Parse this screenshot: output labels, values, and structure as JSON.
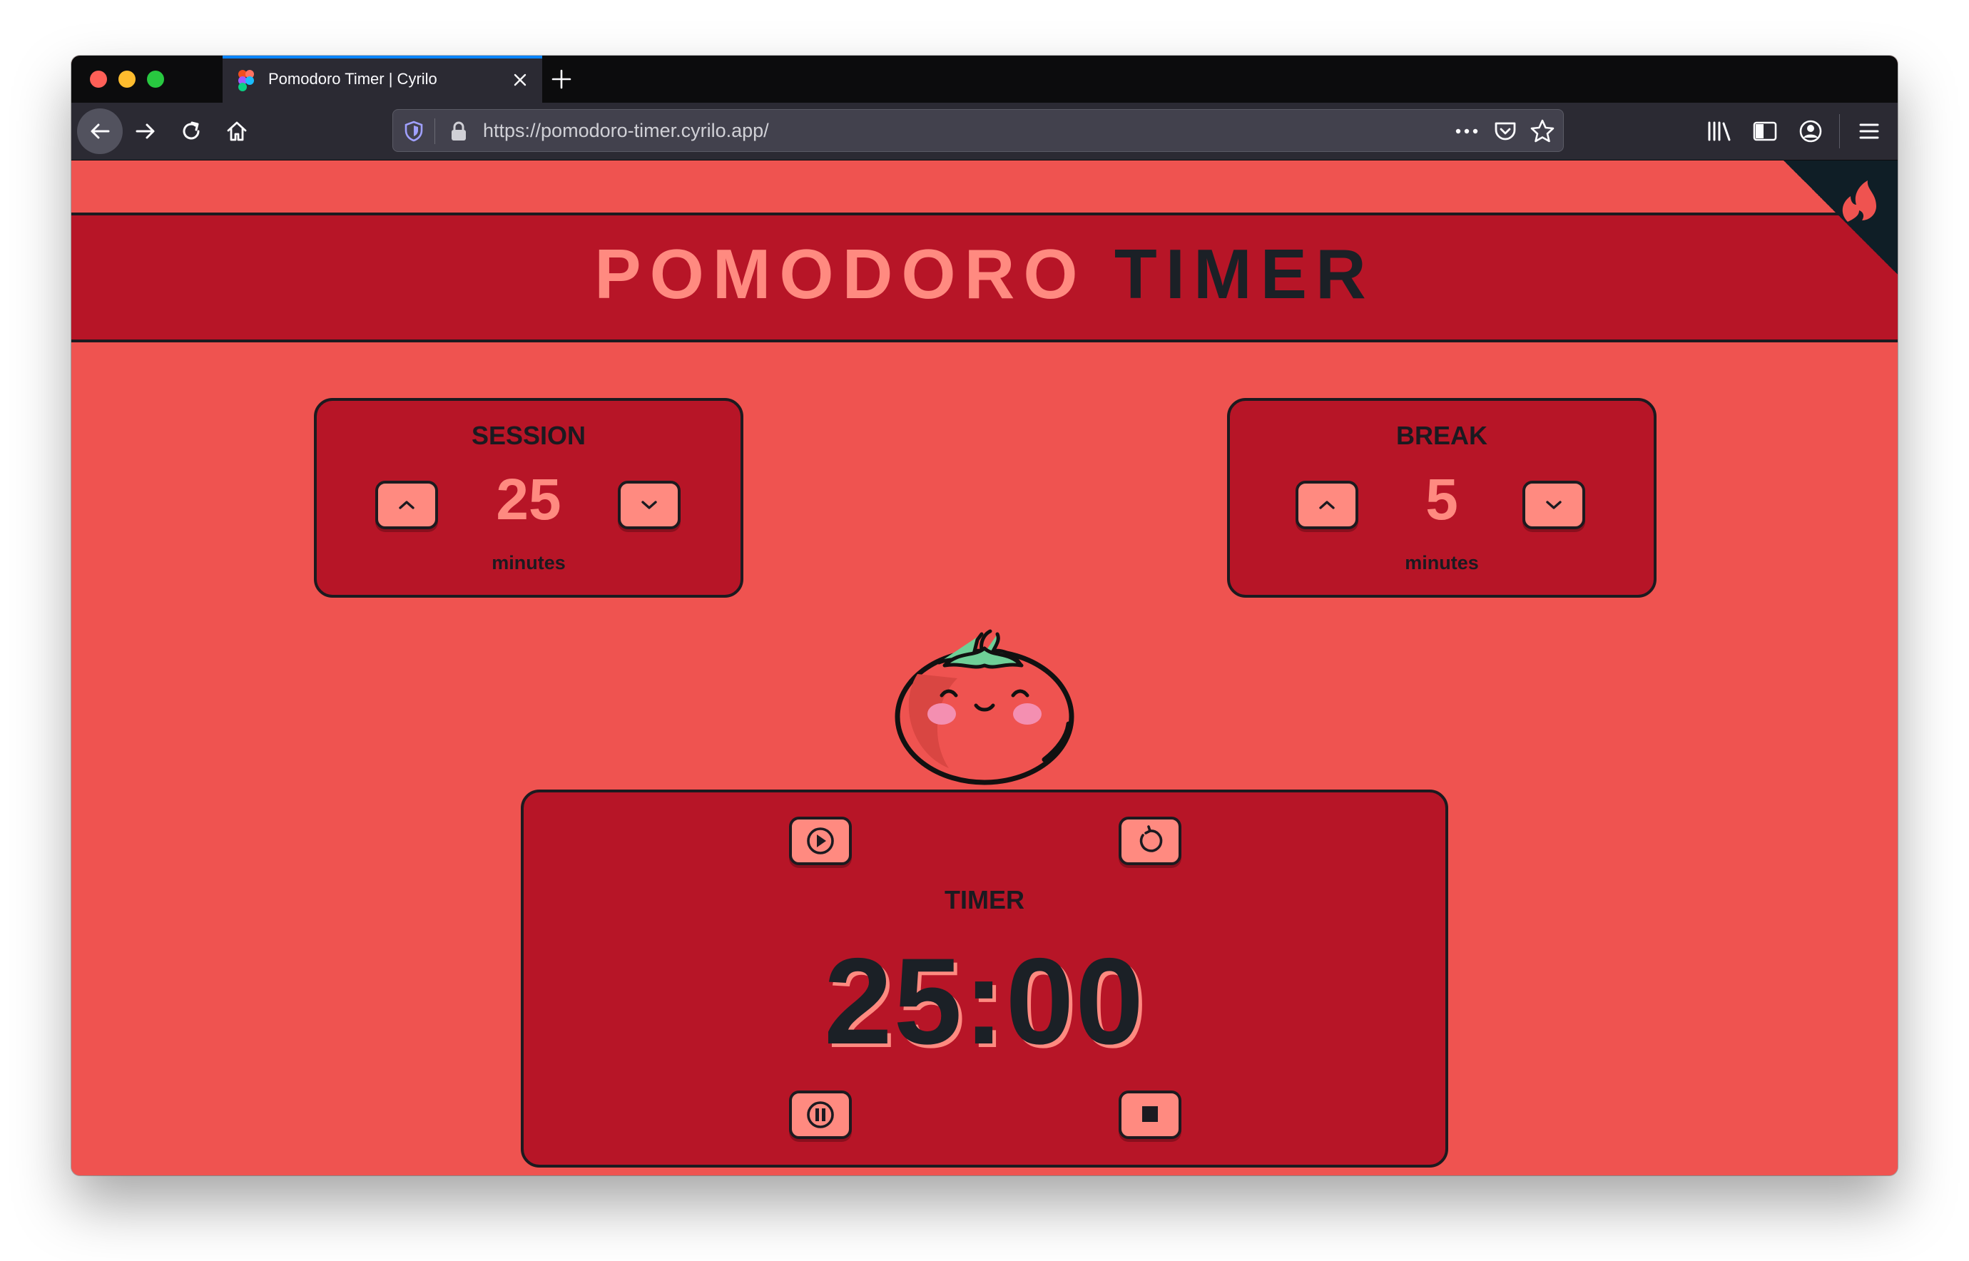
{
  "browser": {
    "tab": {
      "title": "Pomodoro Timer | Cyrilo"
    },
    "address": {
      "url": "https://pomodoro-timer.cyrilo.app/"
    }
  },
  "colors": {
    "page_background": "#ef5350",
    "panel": "#b71527",
    "accent": "#ff8a80",
    "dark": "#1b2026"
  },
  "page": {
    "title_part1": "POMODORO",
    "title_part2": "TIMER",
    "session": {
      "label": "SESSION",
      "value": "25",
      "unit": "minutes"
    },
    "break": {
      "label": "BREAK",
      "value": "5",
      "unit": "minutes"
    },
    "timer": {
      "label": "TIMER",
      "display": "25:00"
    }
  },
  "icons": {
    "session_increase": "chevron-up-icon",
    "session_decrease": "chevron-down-icon",
    "break_increase": "chevron-up-icon",
    "break_decrease": "chevron-down-icon",
    "play": "play-icon",
    "reset": "reset-icon",
    "pause": "pause-icon",
    "stop": "stop-icon",
    "mascot": "tomato-mascot",
    "corner_logo": "flame-logo-icon"
  }
}
